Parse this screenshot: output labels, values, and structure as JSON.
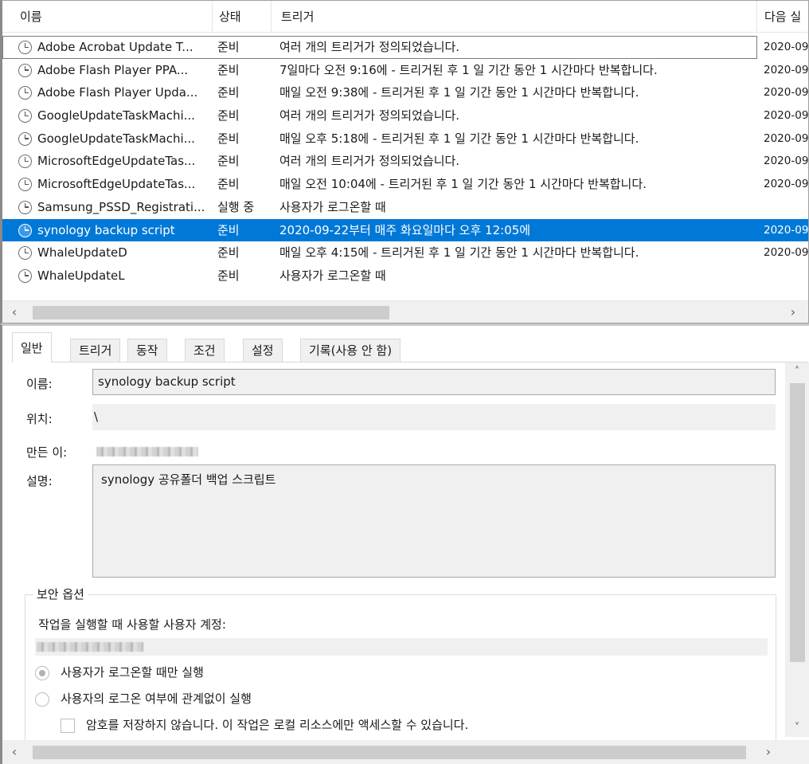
{
  "columns": {
    "name": "이름",
    "status": "상태",
    "trigger": "트리거",
    "next": "다음 실"
  },
  "tasks": [
    {
      "name": "Adobe Acrobat Update T...",
      "status": "준비",
      "trigger": "여러 개의 트리거가 정의되었습니다.",
      "next": "2020-09"
    },
    {
      "name": "Adobe Flash Player PPA...",
      "status": "준비",
      "trigger": "7일마다 오전 9:16에 - 트리거된 후 1 일 기간 동안 1 시간마다 반복합니다.",
      "next": "2020-09"
    },
    {
      "name": "Adobe Flash Player Upda...",
      "status": "준비",
      "trigger": "매일 오전 9:38에 - 트리거된 후 1 일 기간 동안 1 시간마다 반복합니다.",
      "next": "2020-09"
    },
    {
      "name": "GoogleUpdateTaskMachi...",
      "status": "준비",
      "trigger": "여러 개의 트리거가 정의되었습니다.",
      "next": "2020-09"
    },
    {
      "name": "GoogleUpdateTaskMachi...",
      "status": "준비",
      "trigger": "매일 오후 5:18에 - 트리거된 후 1 일 기간 동안 1 시간마다 반복합니다.",
      "next": "2020-09"
    },
    {
      "name": "MicrosoftEdgeUpdateTas...",
      "status": "준비",
      "trigger": "여러 개의 트리거가 정의되었습니다.",
      "next": "2020-09"
    },
    {
      "name": "MicrosoftEdgeUpdateTas...",
      "status": "준비",
      "trigger": "매일 오전 10:04에 - 트리거된 후 1 일 기간 동안 1 시간마다 반복합니다.",
      "next": "2020-09"
    },
    {
      "name": "Samsung_PSSD_Registrati...",
      "status": "실행 중",
      "trigger": "사용자가 로그온할 때",
      "next": ""
    },
    {
      "name": "synology backup script",
      "status": "준비",
      "trigger": "2020-09-22부터 매주 화요일마다 오후 12:05에",
      "next": "2020-09"
    },
    {
      "name": "WhaleUpdateD",
      "status": "준비",
      "trigger": "매일 오후 4:15에 - 트리거된 후 1 일 기간 동안 1 시간마다 반복합니다.",
      "next": "2020-09"
    },
    {
      "name": "WhaleUpdateL",
      "status": "준비",
      "trigger": "사용자가 로그온할 때",
      "next": ""
    }
  ],
  "tabs": [
    "일반",
    "트리거",
    "동작",
    "조건",
    "설정",
    "기록(사용 안 함)"
  ],
  "general": {
    "name_label": "이름:",
    "name_value": "synology backup script",
    "location_label": "위치:",
    "location_value": "\\",
    "author_label": "만든 이:",
    "description_label": "설명:",
    "description_value": "synology 공유폴더 백업 스크립트"
  },
  "security": {
    "title": "보안 옵션",
    "account_label": "작업을 실행할 때 사용할 사용자 계정:",
    "option_logged_on": "사용자가 로그온할 때만 실행",
    "option_any": "사용자의 로그온 여부에 관계없이 실행",
    "option_no_password": "암호를 저장하지 않습니다. 이 작업은 로컬 리소스에만 액세스할 수 있습니다."
  }
}
